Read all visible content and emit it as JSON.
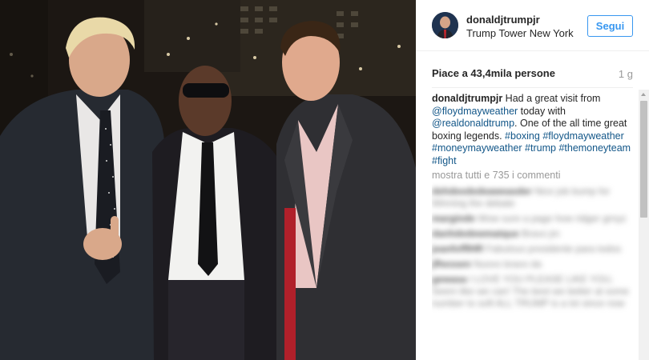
{
  "post": {
    "image_alt": "Photo of three men posing together"
  },
  "header": {
    "username": "donaldjtrumpjr",
    "location": "Trump Tower New York",
    "follow_label": "Segui"
  },
  "stats": {
    "likes": "Piace a 43,4mila persone",
    "time": "1 g"
  },
  "caption": {
    "username": "donaldjtrumpjr",
    "text_1": " Had a great visit from ",
    "mention_1": "@floydmayweather",
    "text_2": " today with ",
    "mention_2": "@realdonaldtrump",
    "text_3": ". One of the all time great boxing legends. ",
    "hashtag_1": "#boxing",
    "hashtag_2": "#floydmayweather",
    "hashtag_3": "#moneymayweather",
    "hashtag_4": "#trump",
    "hashtag_5": "#themoneyteam",
    "hashtag_6": "#fight"
  },
  "view_all": "mostra tutti e 735 i commenti",
  "comments": [
    {
      "user": "dehdeededeaweasder",
      "text": "Nice job bump for Winning the debate"
    },
    {
      "user": "marginde",
      "text": "Wow sure a page how ridger grnyz"
    },
    {
      "user": "danhdedewmatque",
      "text": "Bravo jm"
    },
    {
      "user": "jeanfofflHR",
      "text": "Fabulous presidente para todos"
    },
    {
      "user": "jfhessen",
      "text": "Nuovo bravo da"
    },
    {
      "user": "gewasa",
      "text": "I LOVE YOU PLEASE LIKE YOU, Seem like we can! The best we better at some number to soft ALL TRUMP is a lot since now"
    }
  ]
}
